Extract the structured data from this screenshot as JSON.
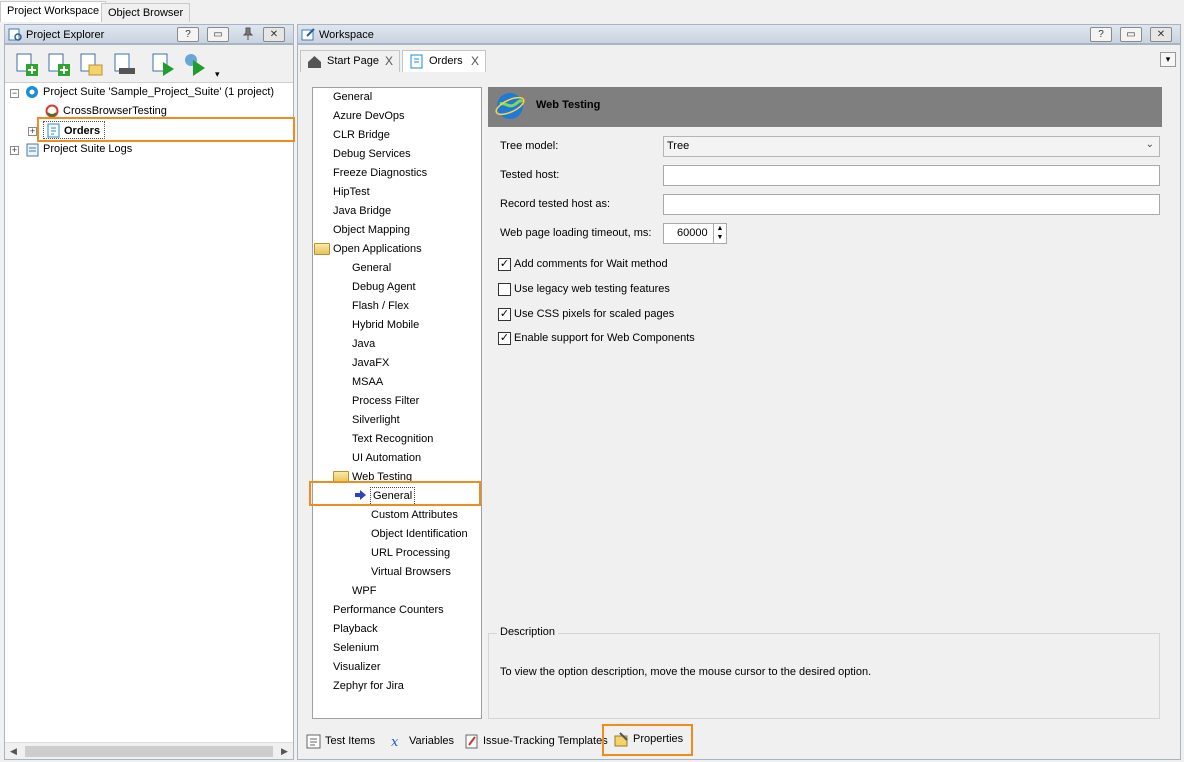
{
  "top_tabs": [
    "Project Workspace",
    "Object Browser"
  ],
  "explorer": {
    "title": "Project Explorer",
    "buttons": [
      "?",
      "▭",
      "⊕",
      "✕"
    ],
    "tree": [
      {
        "label": "Project Suite 'Sample_Project_Suite' (1 project)"
      },
      {
        "label": "CrossBrowserTesting"
      },
      {
        "label": "Orders"
      },
      {
        "label": "Project Suite Logs"
      }
    ]
  },
  "workspace": {
    "title": "Workspace",
    "buttons": [
      "?",
      "▭",
      "✕"
    ],
    "tabs": [
      {
        "label": "Start Page",
        "close": "X"
      },
      {
        "label": "Orders",
        "close": "X"
      }
    ],
    "options": [
      "General",
      "Azure DevOps",
      "CLR Bridge",
      "Debug Services",
      "Freeze Diagnostics",
      "HipTest",
      "Java Bridge",
      "Object Mapping",
      "Open Applications",
      "General",
      "Debug Agent",
      "Flash / Flex",
      "Hybrid Mobile",
      "Java",
      "JavaFX",
      "MSAA",
      "Process Filter",
      "Silverlight",
      "Text Recognition",
      "UI Automation",
      "Web Testing",
      "General",
      "Custom Attributes",
      "Object Identification",
      "URL Processing",
      "Virtual Browsers",
      "WPF",
      "Performance Counters",
      "Playback",
      "Selenium",
      "Visualizer",
      "Zephyr for Jira"
    ],
    "page": {
      "title": "Web Testing",
      "tree_model_label": "Tree model:",
      "tree_model_value": "Tree",
      "tested_host_label": "Tested host:",
      "tested_host_value": "",
      "record_host_label": "Record tested host as:",
      "record_host_value": "",
      "timeout_label": "Web page loading timeout, ms:",
      "timeout_value": "60000",
      "checkboxes": [
        {
          "label": "Add comments for Wait method",
          "checked": true
        },
        {
          "label": "Use legacy web testing features",
          "checked": false
        },
        {
          "label": "Use CSS pixels for scaled pages",
          "checked": true
        },
        {
          "label": "Enable support for Web Components",
          "checked": true
        }
      ],
      "description_title": "Description",
      "description_text": "To view the option description, move the mouse cursor to the desired option."
    },
    "bottom_tabs": [
      "Test Items",
      "Variables",
      "Issue-Tracking Templates",
      "Properties"
    ]
  },
  "colors": {
    "highlight": "#f08c1e",
    "banner": "#7f7f7f"
  }
}
